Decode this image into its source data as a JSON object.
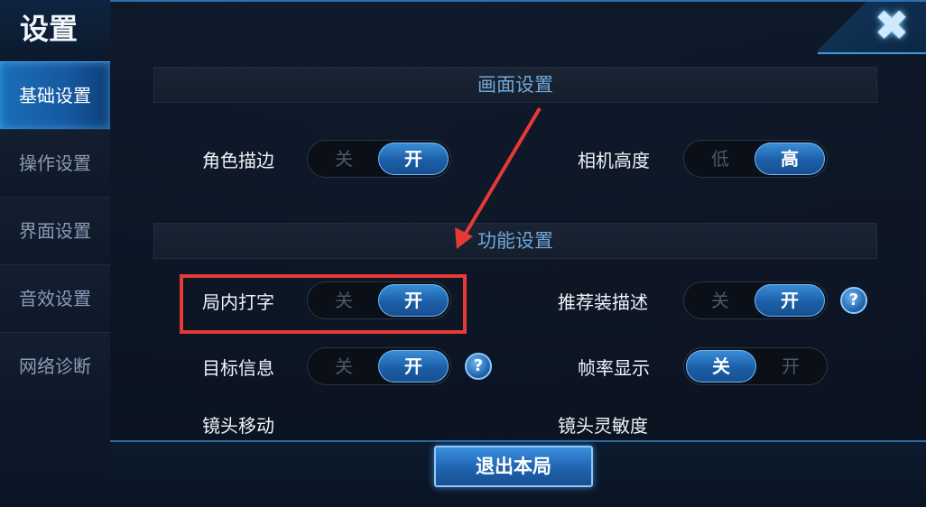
{
  "sidebar": {
    "title": "设置",
    "items": [
      {
        "label": "基础设置",
        "active": true
      },
      {
        "label": "操作设置",
        "active": false
      },
      {
        "label": "界面设置",
        "active": false
      },
      {
        "label": "音效设置",
        "active": false
      },
      {
        "label": "网络诊断",
        "active": false
      }
    ]
  },
  "sections": {
    "display": "画面设置",
    "function": "功能设置"
  },
  "settings": {
    "role_outline": {
      "label": "角色描边",
      "off": "关",
      "on": "开",
      "selected": "开"
    },
    "camera_height": {
      "label": "相机高度",
      "off": "低",
      "on": "高",
      "selected": "高"
    },
    "in_game_typing": {
      "label": "局内打字",
      "off": "关",
      "on": "开",
      "selected": "开"
    },
    "recommend_gear_desc": {
      "label": "推荐装描述",
      "off": "关",
      "on": "开",
      "selected": "开"
    },
    "target_info": {
      "label": "目标信息",
      "off": "关",
      "on": "开",
      "selected": "开"
    },
    "fps_display": {
      "label": "帧率显示",
      "off": "关",
      "on": "开",
      "selected": "关"
    },
    "camera_move": {
      "label": "镜头移动"
    },
    "camera_sensitivity": {
      "label": "镜头灵敏度"
    }
  },
  "help_glyph": "?",
  "close_glyph": "✖",
  "exit_button": "退出本局",
  "colors": {
    "accent": "#1b5ea7",
    "highlight": "#e53a35"
  }
}
